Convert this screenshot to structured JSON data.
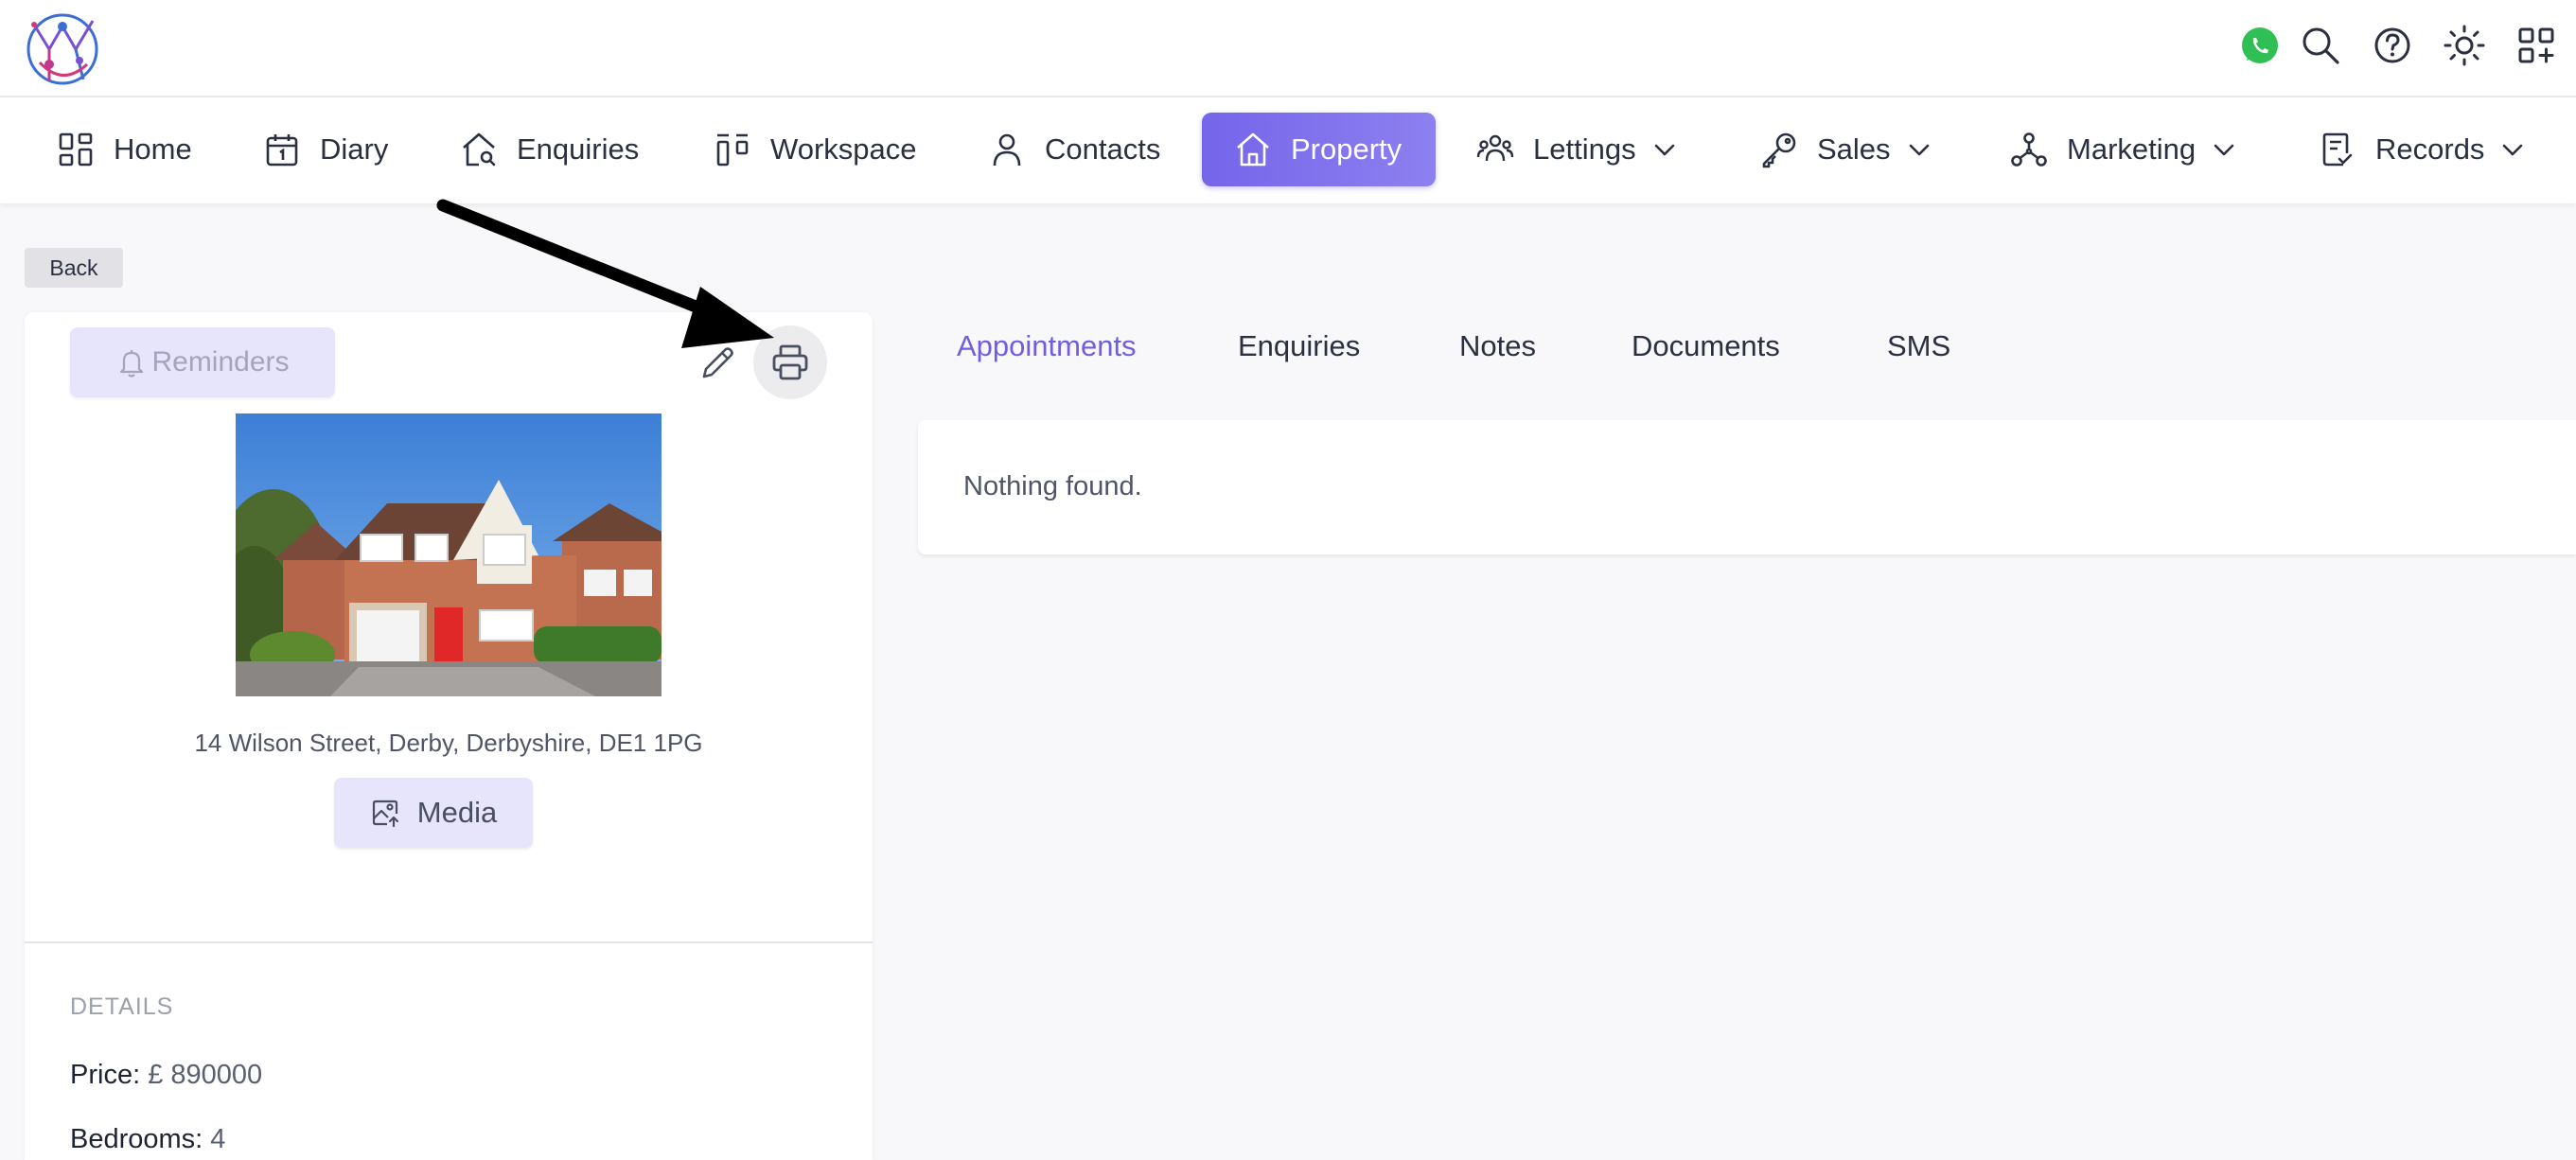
{
  "header": {
    "icons": [
      "whatsapp-icon",
      "search-icon",
      "help-icon",
      "theme-sun-icon",
      "apps-add-icon"
    ]
  },
  "nav": {
    "items": [
      {
        "label": "Home",
        "icon": "dashboard-icon"
      },
      {
        "label": "Diary",
        "icon": "calendar-icon"
      },
      {
        "label": "Enquiries",
        "icon": "house-search-icon"
      },
      {
        "label": "Workspace",
        "icon": "kanban-icon"
      },
      {
        "label": "Contacts",
        "icon": "person-icon"
      },
      {
        "label": "Property",
        "icon": "house-icon",
        "active": true
      },
      {
        "label": "Lettings",
        "icon": "people-icon",
        "dropdown": true
      },
      {
        "label": "Sales",
        "icon": "key-icon",
        "dropdown": true
      },
      {
        "label": "Marketing",
        "icon": "network-icon",
        "dropdown": true
      },
      {
        "label": "Records",
        "icon": "document-check-icon",
        "dropdown": true
      }
    ]
  },
  "back_label": "Back",
  "property": {
    "reminders_label": "Reminders",
    "address": "14 Wilson Street, Derby, Derbyshire, DE1 1PG",
    "media_label": "Media",
    "details_heading": "DETAILS",
    "details": [
      {
        "label": "Price:",
        "value": " £ 890000"
      },
      {
        "label": "Bedrooms:",
        "value": " 4"
      }
    ]
  },
  "tabs": [
    {
      "label": "Appointments",
      "active": true
    },
    {
      "label": "Enquiries"
    },
    {
      "label": "Notes"
    },
    {
      "label": "Documents"
    },
    {
      "label": "SMS"
    }
  ],
  "panel": {
    "empty_text": "Nothing found."
  },
  "colors": {
    "accent": "#7565ea",
    "accent_light": "#e7e5fb",
    "whatsapp": "#2fbf54",
    "background": "#f8f8fa"
  }
}
